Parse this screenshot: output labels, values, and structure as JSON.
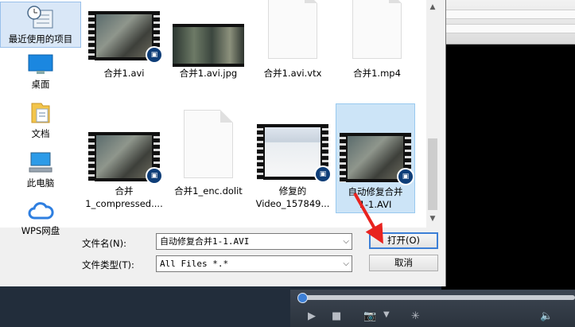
{
  "places": [
    {
      "label": "最近使用的项目",
      "icon": "recent-items-icon"
    },
    {
      "label": "桌面",
      "icon": "desktop-icon"
    },
    {
      "label": "文档",
      "icon": "documents-icon"
    },
    {
      "label": "此电脑",
      "icon": "computer-icon"
    },
    {
      "label": "WPS网盘",
      "icon": "cloud-icon"
    }
  ],
  "files": [
    {
      "name": "合并1.avi",
      "type": "video"
    },
    {
      "name": "合并1.avi.jpg",
      "type": "image"
    },
    {
      "name": "合并1.avi.vtx",
      "type": "document"
    },
    {
      "name": "合并1.mp4",
      "type": "document"
    },
    {
      "name": "合并",
      "name2": "1_compressed....",
      "type": "video"
    },
    {
      "name": "合并1_enc.dolit",
      "type": "document"
    },
    {
      "name": "修复的",
      "name2": "Video_157849...",
      "type": "video-ui"
    },
    {
      "name": "自动修复合并",
      "name2": "1-1.AVI",
      "type": "video",
      "selected": true
    }
  ],
  "filename": {
    "label": "文件名(N):",
    "value": "自动修复合并1-1.AVI"
  },
  "filetype": {
    "label": "文件类型(T):",
    "value": "All Files *.*"
  },
  "buttons": {
    "open": "打开(O)",
    "cancel": "取消"
  },
  "colors": {
    "accent": "#3c7fd6",
    "selection": "#cce4f7",
    "annotation_arrow": "#e8231f"
  }
}
